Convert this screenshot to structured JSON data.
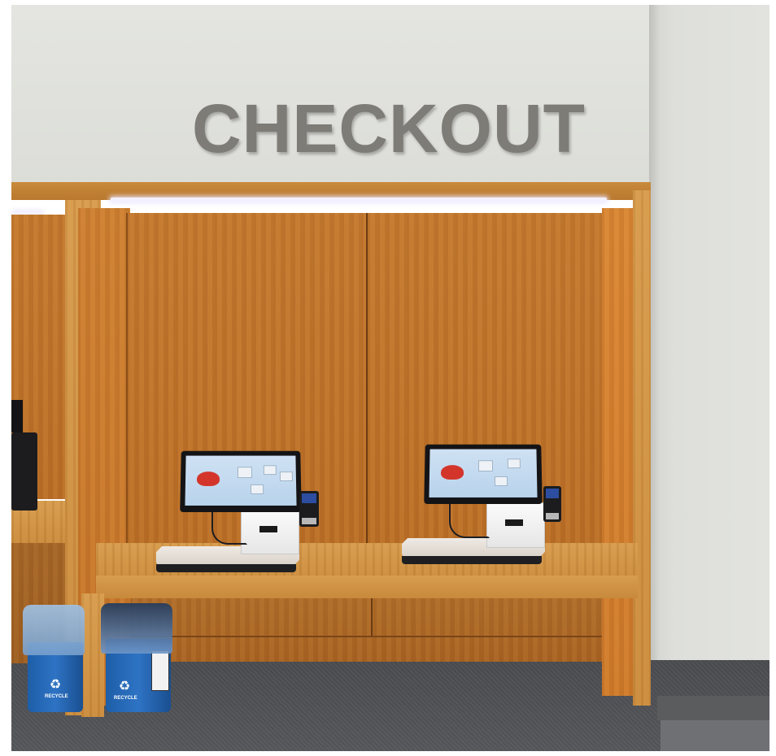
{
  "sign": {
    "text": "CHECKOUT"
  },
  "bins": [
    {
      "label": "RECYCLE"
    },
    {
      "label": "RECYCLE"
    }
  ],
  "icons": {
    "recycle": "recycle-icon"
  }
}
